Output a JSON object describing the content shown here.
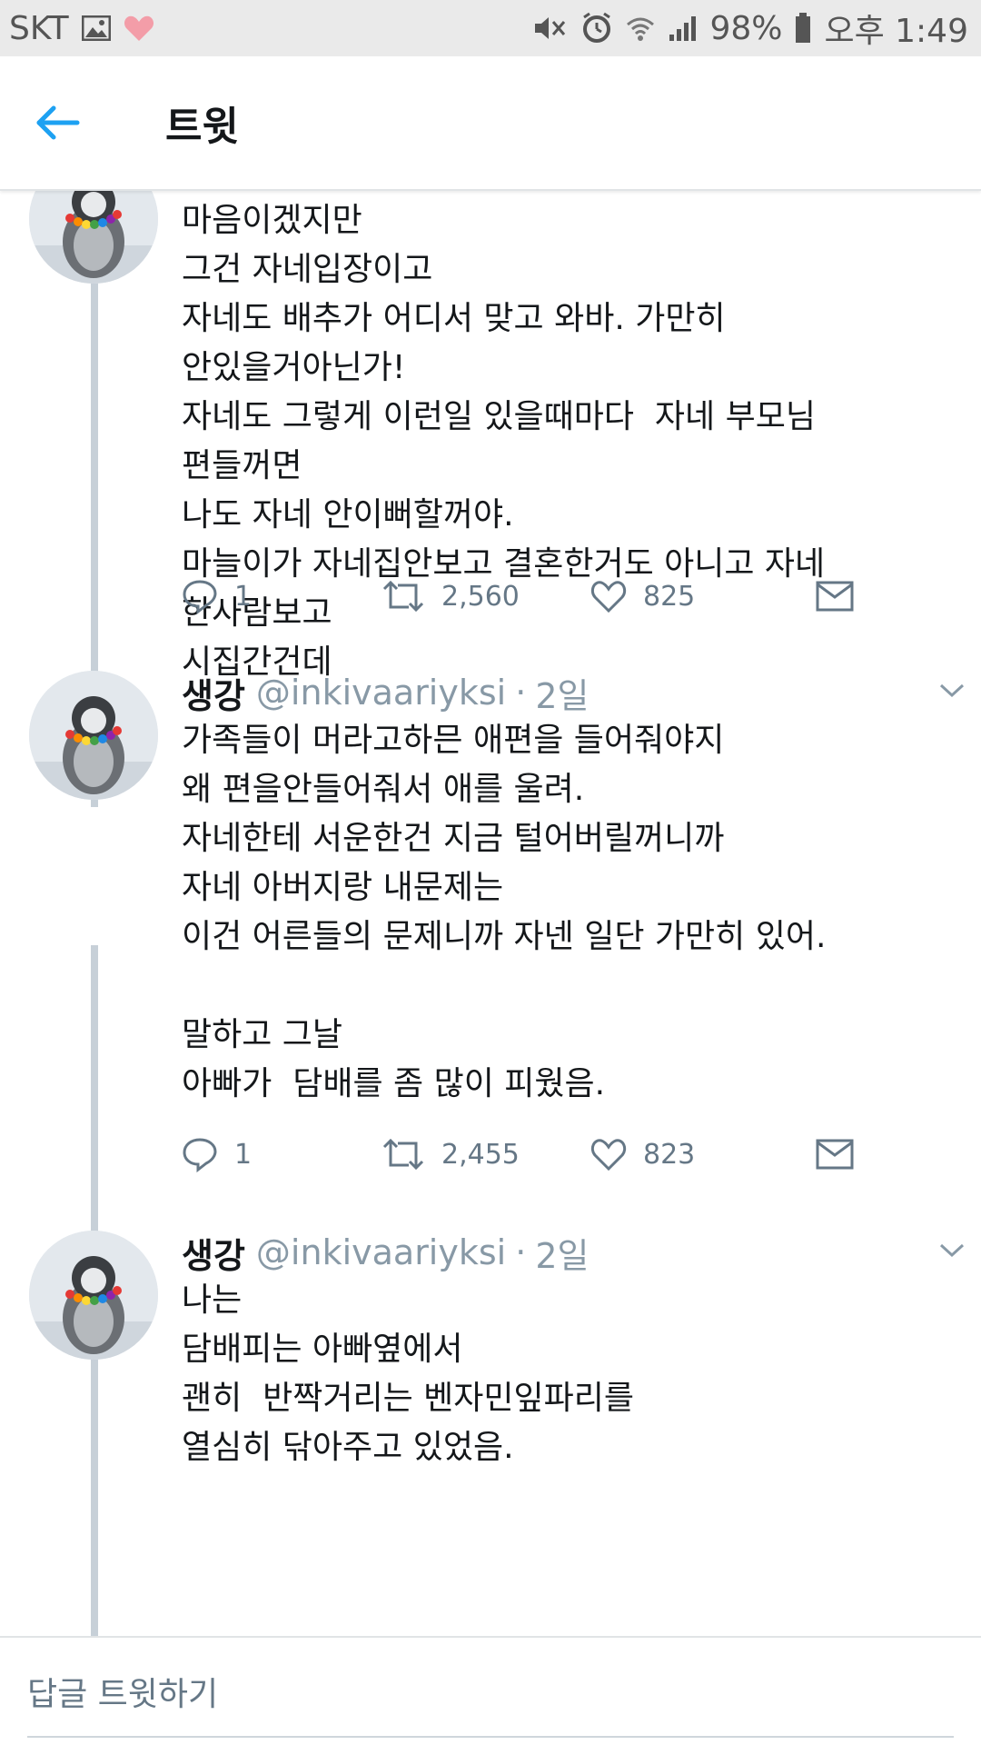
{
  "status_bar": {
    "carrier": "SKT",
    "battery": "98%",
    "time": "오후 1:49"
  },
  "header": {
    "title": "트윗"
  },
  "tweets": [
    {
      "name": "",
      "handle": "",
      "time": "",
      "text": "마음이겠지만\n그건 자네입장이고\n자네도 배추가 어디서 맞고 와바. 가만히\n안있을거아닌가!\n자네도 그렇게 이런일 있을때마다  자네 부모님\n편들꺼면\n나도 자네 안이뻐할꺼야.\n마늘이가 자네집안보고 결혼한거도 아니고 자네\n한사람보고\n시집간건데",
      "replies": "1",
      "retweets": "2,560",
      "likes": "825"
    },
    {
      "name": "생강",
      "handle": "@inkivaariyksi",
      "time": "2일",
      "text": "가족들이 머라고하믄 애편을 들어줘야지\n왜 편을안들어줘서 애를 울려.\n자네한테 서운한건 지금 털어버릴꺼니까\n자네 아버지랑 내문제는\n이건 어른들의 문제니까 자넨 일단 가만히 있어.\n\n말하고 그날\n아빠가  담배를 좀 많이 피웠음.",
      "replies": "1",
      "retweets": "2,455",
      "likes": "823"
    },
    {
      "name": "생강",
      "handle": "@inkivaariyksi",
      "time": "2일",
      "text": "나는\n담배피는 아빠옆에서\n괜히  반짝거리는 벤자민잎파리를\n열심히 닦아주고 있었음."
    }
  ],
  "reply_bar": {
    "placeholder": "답글 트윗하기"
  },
  "colors": {
    "accent": "#1da1f2",
    "muted": "#8899a6",
    "thread_line": "#c7d0d8"
  }
}
